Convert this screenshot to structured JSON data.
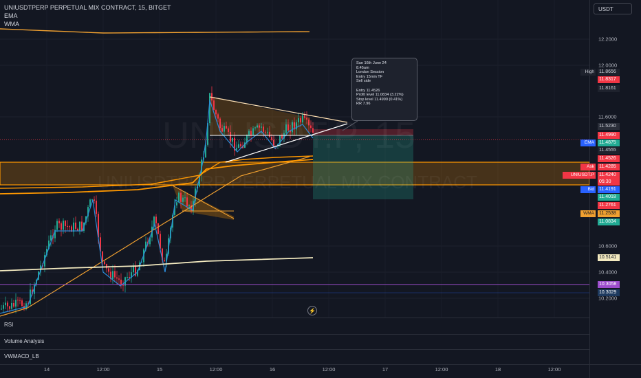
{
  "legend": {
    "symbol_line": "UNIUSDTPERP PERPETUAL MIX CONTRACT, 15, BITGET",
    "indicator1": "EMA",
    "indicator2": "WMA"
  },
  "currency_button": "USDT",
  "watermark": {
    "big": "UNIUSDT.P, 15",
    "small": "UNIUSDTPERP PERPETUAL MIX CONTRACT"
  },
  "note": {
    "lines": [
      "Sun 16th June 24",
      "8.45am",
      "London Session",
      "Entry 15min TF",
      "Sell side",
      "",
      "Entry 11.4526",
      "Profit level 11.0834 (3.22%)",
      "Stop level 11.4990 (0.41%)",
      "RR 7.96"
    ]
  },
  "panes": [
    "RSI",
    "Volume Analysis",
    "VWMACD_LB"
  ],
  "flash_icon": "⚡",
  "x_axis": {
    "labels": [
      {
        "text": "14"
      },
      {
        "text": "12:00"
      },
      {
        "text": "15"
      },
      {
        "text": "12:00"
      },
      {
        "text": "16"
      },
      {
        "text": "12:00"
      },
      {
        "text": "17"
      },
      {
        "text": "12:00"
      },
      {
        "text": "18"
      },
      {
        "text": "12:00"
      }
    ]
  },
  "y_axis": {
    "ticks": [
      "12.2000",
      "12.0000",
      "11.6000",
      "10.6000",
      "10.4000",
      "10.2000"
    ]
  },
  "price_badges": [
    {
      "value": "11.8656",
      "label": "High",
      "bg": "#1e222d",
      "color": "#d1d4dc",
      "label_bg": "#1e222d"
    },
    {
      "value": "11.8317",
      "label": "",
      "bg": "#f23645",
      "color": "#ffffff"
    },
    {
      "value": "11.8161",
      "label": "",
      "bg": "#1e222d",
      "color": "#d1d4dc"
    },
    {
      "value": "11.5230",
      "label": "",
      "bg": "#2a2e39",
      "color": "#d1d4dc"
    },
    {
      "value": "11.4990",
      "label": "",
      "bg": "#f23645",
      "color": "#ffffff"
    },
    {
      "value": "11.4875",
      "label": "EMA",
      "bg": "#22ab94",
      "color": "#ffffff",
      "label_bg": "#2962ff"
    },
    {
      "value": "11.4555",
      "label": "",
      "bg": "#1e222d",
      "color": "#d1d4dc"
    },
    {
      "value": "11.4526",
      "label": "",
      "bg": "#f23645",
      "color": "#ffffff"
    },
    {
      "value": "11.4285",
      "label": "Ask",
      "bg": "#f23645",
      "color": "#ffffff",
      "label_bg": "#f23645"
    },
    {
      "value": "11.4240",
      "label": "UNIUSDT.P",
      "bg": "#f23645",
      "color": "#ffffff",
      "label_bg": "#f23645"
    },
    {
      "value": "05:30",
      "label": "",
      "bg": "#f23645",
      "color": "#ffffff"
    },
    {
      "value": "11.4191",
      "label": "Bid",
      "bg": "#2962ff",
      "color": "#ffffff",
      "label_bg": "#2962ff"
    },
    {
      "value": "11.4018",
      "label": "",
      "bg": "#22ab94",
      "color": "#ffffff"
    },
    {
      "value": "11.2761",
      "label": "",
      "bg": "#f23645",
      "color": "#ffffff"
    },
    {
      "value": "11.2538",
      "label": "WMA",
      "bg": "#f0a030",
      "color": "#131722",
      "label_bg": "#f0a030"
    },
    {
      "value": "11.0834",
      "label": "",
      "bg": "#22ab94",
      "color": "#ffffff"
    },
    {
      "value": "10.5141",
      "label": "",
      "bg": "#f3eac0",
      "color": "#131722"
    },
    {
      "value": "10.3058",
      "label": "",
      "bg": "#9c4dcc",
      "color": "#ffffff"
    },
    {
      "value": "10.3029",
      "label": "",
      "bg": "#1e3a5f",
      "color": "#ffffff"
    }
  ],
  "colors": {
    "background": "#131722",
    "up_candle": "#22ab94",
    "down_candle": "#f23645",
    "ema": "#2a8bd8",
    "wma": "#f0a030",
    "band": "#ff9800",
    "vwap_line": "#f3eac0",
    "purple_line": "#9c4dcc",
    "trendline": "#ffe0b2"
  },
  "icons": [
    "flash-icon"
  ]
}
